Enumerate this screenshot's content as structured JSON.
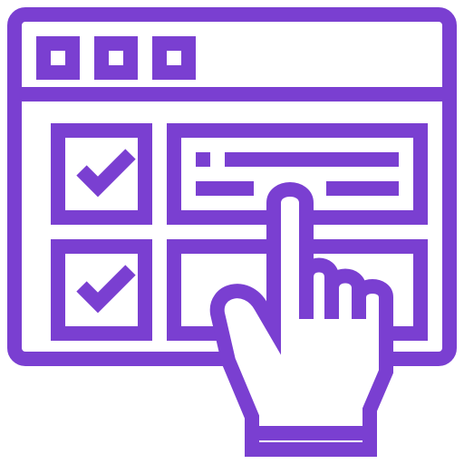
{
  "icon": {
    "name": "online-checklist-touch-icon",
    "color": "#7a3fd1",
    "background": "#ffffff",
    "parts": [
      "browser-window",
      "title-bar-dots",
      "checkbox-checked",
      "checkbox-checked",
      "form-row",
      "form-row",
      "pointing-hand"
    ]
  }
}
